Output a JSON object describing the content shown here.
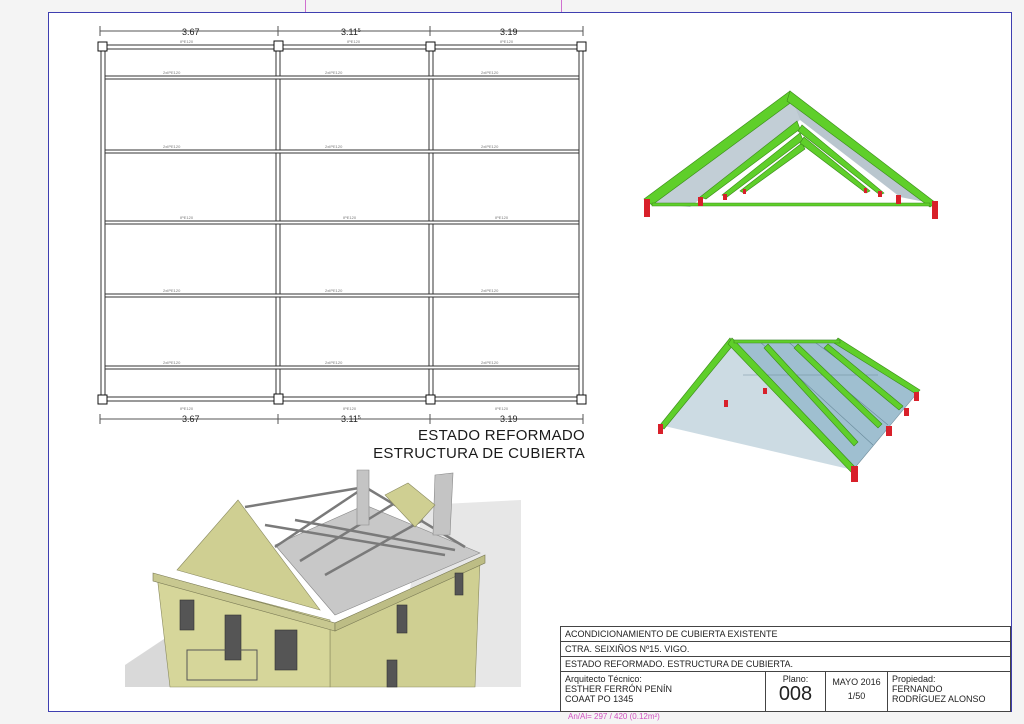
{
  "plan": {
    "dims_top": [
      "3.67",
      "3.11",
      "3.19"
    ],
    "dims_bottom": [
      "3.67",
      "3.11",
      "3.19"
    ],
    "dim_superscript": "5"
  },
  "titles": {
    "line1": "ESTADO REFORMADO",
    "line2": "ESTRUCTURA DE CUBIERTA"
  },
  "title_block": {
    "project": "ACONDICIONAMIENTO DE CUBIERTA EXISTENTE",
    "address": "CTRA. SEIXIÑOS Nº15. VIGO.",
    "sheet_title": "ESTADO REFORMADO. ESTRUCTURA DE CUBIERTA.",
    "architect_label": "Arquitecto Técnico:",
    "architect_name": "ESTHER FERRÓN PENÍN",
    "architect_reg": "COAAT PO 1345",
    "plano_label": "Plano:",
    "plano_number": "008",
    "date": "MAYO 2016",
    "scale": "1/50",
    "owner_label": "Propiedad:",
    "owner_name_1": "FERNANDO",
    "owner_name_2": "RODRÍGUEZ ALONSO"
  },
  "footer_note": "An/Al= 297 / 420 (0.12m²)",
  "colors": {
    "frame": "#3f3fb0",
    "beam_green": "#5fcf2a",
    "column_red": "#d8202a",
    "glass": "#8fb4c8",
    "wall_beige": "#d6d69a"
  }
}
